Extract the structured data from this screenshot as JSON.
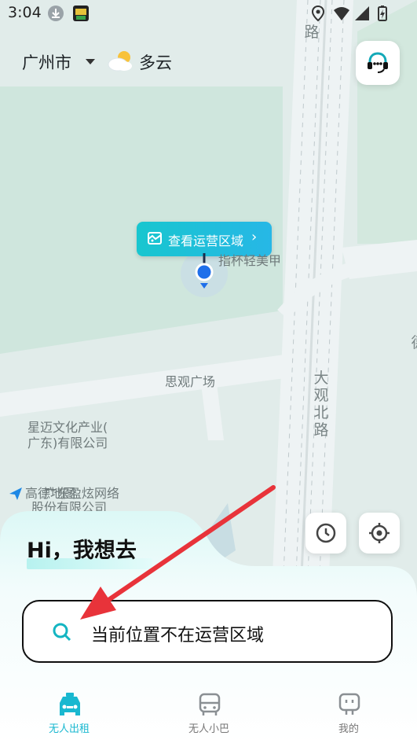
{
  "status_bar": {
    "time": "3:04"
  },
  "header": {
    "city": "广州市",
    "weather": "多云"
  },
  "map": {
    "area_button": "查看运营区域",
    "labels": {
      "poi_nail": "指杯轻美甲",
      "square": "思观广场",
      "company1_line1": "星迈文化产业(",
      "company1_line2": "广东)有限公司",
      "company2_line1": "广东盈炫网络",
      "company2_line2": "股份有限公司",
      "road_top": "路",
      "road_main": "大观北路",
      "road_right": "德",
      "logo_text": "高德地图"
    }
  },
  "sheet": {
    "greeting": "Hi，我想去",
    "search_text": "当前位置不在运营区域"
  },
  "tabs": [
    {
      "label": "无人出租",
      "icon": "taxi-icon",
      "active": true
    },
    {
      "label": "无人小巴",
      "icon": "bus-icon",
      "active": false
    },
    {
      "label": "我的",
      "icon": "profile-icon",
      "active": false
    }
  ],
  "colors": {
    "accent": "#19b8d0",
    "annotation_arrow": "#e8333a"
  }
}
